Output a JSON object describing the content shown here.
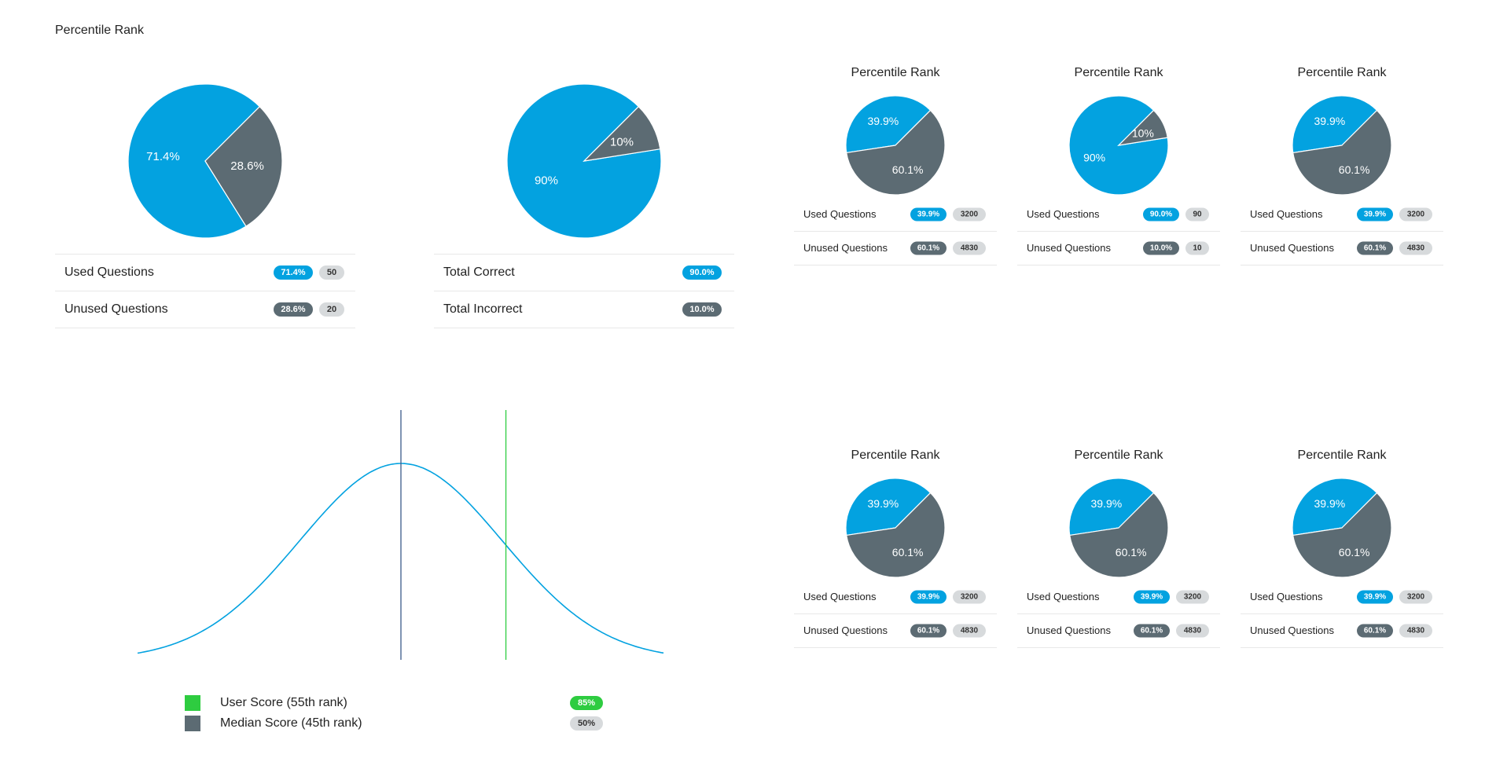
{
  "page_title": "Percentile Rank",
  "colors": {
    "blue": "#03a2e0",
    "slate": "#5c6b73",
    "green": "#2ecc40",
    "gray": "#d7dadc"
  },
  "chart_data": [
    {
      "type": "pie",
      "slices": [
        {
          "label": "71.4%",
          "value": 71.4,
          "color": "#03a2e0"
        },
        {
          "label": "28.6%",
          "value": 28.6,
          "color": "#5c6b73"
        }
      ],
      "table": [
        {
          "label": "Used Questions",
          "percent": "71.4%",
          "count": "50",
          "percent_color": "blue"
        },
        {
          "label": "Unused Questions",
          "percent": "28.6%",
          "count": "20",
          "percent_color": "slate"
        }
      ]
    },
    {
      "type": "pie",
      "slices": [
        {
          "label": "90%",
          "value": 90,
          "color": "#03a2e0"
        },
        {
          "label": "10%",
          "value": 10,
          "color": "#5c6b73"
        }
      ],
      "table": [
        {
          "label": "Total Correct",
          "percent": "90.0%",
          "count": "",
          "percent_color": "blue"
        },
        {
          "label": "Total Incorrect",
          "percent": "10.0%",
          "count": "",
          "percent_color": "slate"
        }
      ]
    },
    {
      "type": "pie",
      "title": "Percentile Rank",
      "slices": [
        {
          "label": "39.9%",
          "value": 39.9,
          "color": "#03a2e0"
        },
        {
          "label": "60.1%",
          "value": 60.1,
          "color": "#5c6b73"
        }
      ],
      "table": [
        {
          "label": "Used Questions",
          "percent": "39.9%",
          "count": "3200",
          "percent_color": "blue"
        },
        {
          "label": "Unused Questions",
          "percent": "60.1%",
          "count": "4830",
          "percent_color": "slate"
        }
      ]
    },
    {
      "type": "pie",
      "title": "Percentile Rank",
      "slices": [
        {
          "label": "90%",
          "value": 90,
          "color": "#03a2e0"
        },
        {
          "label": "10%",
          "value": 10,
          "color": "#5c6b73"
        }
      ],
      "table": [
        {
          "label": "Used Questions",
          "percent": "90.0%",
          "count": "90",
          "percent_color": "blue"
        },
        {
          "label": "Unused Questions",
          "percent": "10.0%",
          "count": "10",
          "percent_color": "slate"
        }
      ]
    },
    {
      "type": "pie",
      "title": "Percentile Rank",
      "slices": [
        {
          "label": "39.9%",
          "value": 39.9,
          "color": "#03a2e0"
        },
        {
          "label": "60.1%",
          "value": 60.1,
          "color": "#5c6b73"
        }
      ],
      "table": [
        {
          "label": "Used Questions",
          "percent": "39.9%",
          "count": "3200",
          "percent_color": "blue"
        },
        {
          "label": "Unused Questions",
          "percent": "60.1%",
          "count": "4830",
          "percent_color": "slate"
        }
      ]
    },
    {
      "type": "pie",
      "title": "Percentile Rank",
      "slices": [
        {
          "label": "39.9%",
          "value": 39.9,
          "color": "#03a2e0"
        },
        {
          "label": "60.1%",
          "value": 60.1,
          "color": "#5c6b73"
        }
      ],
      "table": [
        {
          "label": "Used Questions",
          "percent": "39.9%",
          "count": "3200",
          "percent_color": "blue"
        },
        {
          "label": "Unused Questions",
          "percent": "60.1%",
          "count": "4830",
          "percent_color": "slate"
        }
      ]
    },
    {
      "type": "pie",
      "title": "Percentile Rank",
      "slices": [
        {
          "label": "39.9%",
          "value": 39.9,
          "color": "#03a2e0"
        },
        {
          "label": "60.1%",
          "value": 60.1,
          "color": "#5c6b73"
        }
      ],
      "table": [
        {
          "label": "Used Questions",
          "percent": "39.9%",
          "count": "3200",
          "percent_color": "blue"
        },
        {
          "label": "Unused Questions",
          "percent": "60.1%",
          "count": "4830",
          "percent_color": "slate"
        }
      ]
    },
    {
      "type": "pie",
      "title": "Percentile Rank",
      "slices": [
        {
          "label": "39.9%",
          "value": 39.9,
          "color": "#03a2e0"
        },
        {
          "label": "60.1%",
          "value": 60.1,
          "color": "#5c6b73"
        }
      ],
      "table": [
        {
          "label": "Used Questions",
          "percent": "39.9%",
          "count": "3200",
          "percent_color": "blue"
        },
        {
          "label": "Unused Questions",
          "percent": "60.1%",
          "count": "4830",
          "percent_color": "slate"
        }
      ]
    },
    {
      "type": "line",
      "description_of_marks": "bell-curve distribution with two vertical markers",
      "curve_color": "#03a2e0",
      "markers": [
        {
          "name": "Median Score",
          "percentile": 50,
          "color": "#5c6b73"
        },
        {
          "name": "User Score",
          "percentile": 85,
          "color": "#2ecc40"
        }
      ],
      "legend": [
        {
          "label": "User Score (55th rank)",
          "badge": "85%",
          "swatch": "green",
          "badge_color": "green"
        },
        {
          "label": "Median Score (45th rank)",
          "badge": "50%",
          "swatch": "slate",
          "badge_color": "gray"
        }
      ]
    }
  ]
}
